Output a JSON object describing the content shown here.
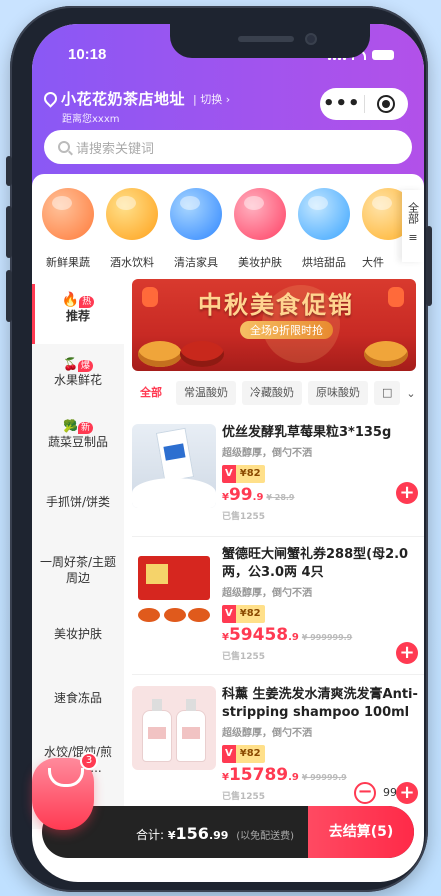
{
  "status": {
    "time": "10:18"
  },
  "header": {
    "shop_name": "小花花奶茶店地址",
    "switch_label": "切换",
    "distance": "距离您xxxm",
    "capsule_more": "•••",
    "search_placeholder": "请搜索关键词"
  },
  "categories": [
    {
      "label": "新鲜果蔬",
      "color": "#ff8a4a",
      "icon": "peach-icon"
    },
    {
      "label": "酒水饮料",
      "color": "#ffb23a",
      "icon": "drink-icon"
    },
    {
      "label": "清洁家具",
      "color": "#4aa6ff",
      "icon": "cleaning-icon"
    },
    {
      "label": "美妆护肤",
      "color": "#ff5a7a",
      "icon": "cosmetics-icon"
    },
    {
      "label": "烘培甜品",
      "color": "#5ab8ff",
      "icon": "cake-icon"
    },
    {
      "label": "大件",
      "color": "#ffc24a",
      "icon": "large-items-icon"
    }
  ],
  "category_all": "全部",
  "sidebar": [
    {
      "label": "推荐",
      "tag": "热",
      "active": true
    },
    {
      "label": "水果鲜花",
      "tag": "爆",
      "active": false
    },
    {
      "label": "蔬菜豆制品",
      "tag": "新",
      "active": false
    },
    {
      "label": "手抓饼/饼类",
      "tag": "",
      "active": false
    },
    {
      "label": "一周好茶/主题周边",
      "tag": "",
      "active": false
    },
    {
      "label": "美妆护肤",
      "tag": "",
      "active": false
    },
    {
      "label": "速食冻品",
      "tag": "",
      "active": false
    },
    {
      "label": "水饺/馄饨/煎饺常温...",
      "tag": "",
      "active": false
    }
  ],
  "banner": {
    "title": "中秋美食促销",
    "subtitle": "全场9折限时抢"
  },
  "filters": [
    "全部",
    "常温酸奶",
    "冷藏酸奶",
    "原味酸奶"
  ],
  "products": [
    {
      "name": "优丝发酵乳草莓果粒3*135g",
      "desc": "超级醇厚，倒勺不洒",
      "vip_price": "¥82",
      "currency": "¥",
      "price_int": "99",
      "price_dec": ".9",
      "orig_price": "¥ 28.9",
      "sold": "已售1255"
    },
    {
      "name": "蟹德旺大闸蟹礼券288型(母2.0两，公3.0两 4只",
      "desc": "超级醇厚，倒勺不洒",
      "vip_price": "¥82",
      "currency": "¥",
      "price_int": "59458",
      "price_dec": ".9",
      "orig_price": "¥ 999999.9",
      "sold": "已售1255"
    },
    {
      "name": "科薰 生姜洗发水清爽洗发膏Anti-stripping shampoo 100ml",
      "desc": "超级醇厚，倒勺不洒",
      "vip_price": "¥82",
      "currency": "¥",
      "price_int": "15789",
      "price_dec": ".9",
      "orig_price": "¥ 99999.9",
      "sold": "已售1255",
      "quantity": "99"
    }
  ],
  "cart": {
    "badge": "3",
    "total_label": "合计:",
    "currency": "¥",
    "total_int": "156",
    "total_dec": ".99",
    "free_shipping": "(以免配送费)",
    "checkout_label": "去结算(5)"
  },
  "colors": {
    "brand_purple": "#8a58f5",
    "accent_red": "#ff3a52"
  }
}
